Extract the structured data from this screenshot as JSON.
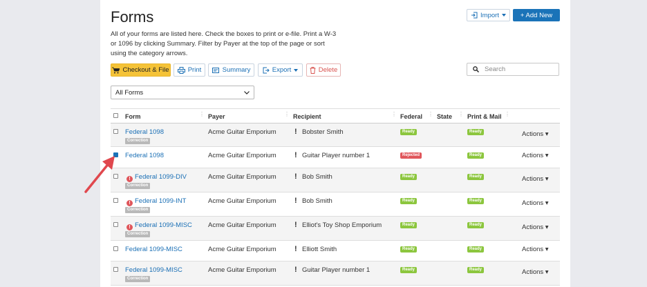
{
  "page": {
    "title": "Forms",
    "description": "All of your forms are listed here. Check the boxes to print or e-file. Print a W-3 or 1096 by clicking Summary. Filter by Payer at the top of the page or sort using the category arrows."
  },
  "top_buttons": {
    "import": "Import",
    "add_new": "+ Add New"
  },
  "toolbar": {
    "checkout": "Checkout & File",
    "print": "Print",
    "summary": "Summary",
    "export": "Export",
    "delete": "Delete",
    "search_placeholder": "Search"
  },
  "filter": {
    "selected": "All Forms"
  },
  "table": {
    "headers": {
      "form": "Form",
      "payer": "Payer",
      "recipient": "Recipient",
      "federal": "Federal",
      "state": "State",
      "print_mail": "Print & Mail"
    },
    "rows": [
      {
        "form": "Federal 1098",
        "error": false,
        "correction": "Correction",
        "payer": "Acme Guitar Emporium",
        "recipient": "Bobster Smith",
        "federal": "Ready",
        "federal_status": "ready",
        "print_mail": "Ready",
        "actions": "Actions",
        "checked": false
      },
      {
        "form": "Federal 1098",
        "error": false,
        "correction": "",
        "payer": "Acme Guitar Emporium",
        "recipient": "Guitar Player number 1",
        "federal": "Rejected",
        "federal_status": "rejected",
        "print_mail": "Ready",
        "actions": "Actions",
        "checked": true
      },
      {
        "form": "Federal 1099-DIV",
        "error": true,
        "correction": "Correction",
        "payer": "Acme Guitar Emporium",
        "recipient": "Bob Smith",
        "federal": "Ready",
        "federal_status": "ready",
        "print_mail": "Ready",
        "actions": "Actions",
        "checked": false
      },
      {
        "form": "Federal 1099-INT",
        "error": true,
        "correction": "Correction",
        "payer": "Acme Guitar Emporium",
        "recipient": "Bob Smith",
        "federal": "Ready",
        "federal_status": "ready",
        "print_mail": "Ready",
        "actions": "Actions",
        "checked": false
      },
      {
        "form": "Federal 1099-MISC",
        "error": true,
        "correction": "Correction",
        "payer": "Acme Guitar Emporium",
        "recipient": "Elliot's Toy Shop Emporium",
        "federal": "Ready",
        "federal_status": "ready",
        "print_mail": "Ready",
        "actions": "Actions",
        "checked": false
      },
      {
        "form": "Federal 1099-MISC",
        "error": false,
        "correction": "",
        "payer": "Acme Guitar Emporium",
        "recipient": "Elliott Smith",
        "federal": "Ready",
        "federal_status": "ready",
        "print_mail": "Ready",
        "actions": "Actions",
        "checked": false
      },
      {
        "form": "Federal 1099-MISC",
        "error": false,
        "correction": "Correction",
        "payer": "Acme Guitar Emporium",
        "recipient": "Guitar Player number 1",
        "federal": "Ready",
        "federal_status": "ready",
        "print_mail": "Ready",
        "actions": "Actions",
        "checked": false
      }
    ]
  },
  "colors": {
    "accent": "#1a73b8",
    "warning": "#f5c338",
    "ready": "#8cc63e",
    "rejected": "#e0565b",
    "annotation_arrow": "#e0484e"
  }
}
